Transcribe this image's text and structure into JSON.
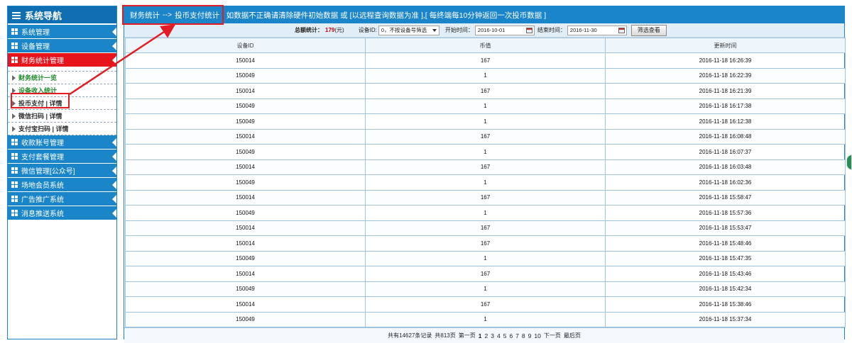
{
  "sidebar": {
    "title": "系统导航",
    "menu": [
      {
        "label": "系统管理"
      },
      {
        "label": "设备管理"
      },
      {
        "label": "财务统计管理"
      }
    ],
    "submenu": [
      {
        "label": "财务统计一览"
      },
      {
        "label": "设备收入统计"
      },
      {
        "label": "投币支付 | 详情"
      },
      {
        "label": "微信扫码 | 详情"
      },
      {
        "label": "支付宝扫码 | 详情"
      }
    ],
    "menu2": [
      {
        "label": "收款账号管理"
      },
      {
        "label": "支付套餐管理"
      },
      {
        "label": "微信管理[公众号]"
      },
      {
        "label": "场地会员系统"
      },
      {
        "label": "广告推广系统"
      },
      {
        "label": "消息推送系统"
      }
    ]
  },
  "topbar": {
    "crumb1": "财务统计",
    "sep": "-->",
    "crumb2": "投币支付统计",
    "notice": "| 如数据不正确请清除硬件初始数据 或 [以远程查询数据为准 ],[ 每终端每10分钟返回一次投币数据 ]"
  },
  "filter": {
    "total_label": "总额统计：",
    "total_value": "179",
    "total_unit": "(元)",
    "device_label": "设备ID:",
    "device_select": "0，不按设备号筛选",
    "start_label": "开始时间：",
    "start_value": "2016-10-01",
    "end_label": "结束时间：",
    "end_value": "2016-11-30",
    "button": "筛选查看"
  },
  "table": {
    "headers": [
      "设备ID",
      "币值",
      "更新时间"
    ],
    "rows": [
      [
        "150014",
        "167",
        "2016-11-18 16:26:39"
      ],
      [
        "150049",
        "1",
        "2016-11-18 16:22:39"
      ],
      [
        "150014",
        "167",
        "2016-11-18 16:21:39"
      ],
      [
        "150049",
        "1",
        "2016-11-18 16:17:38"
      ],
      [
        "150049",
        "1",
        "2016-11-18 16:12:38"
      ],
      [
        "150014",
        "167",
        "2016-11-18 16:08:48"
      ],
      [
        "150049",
        "1",
        "2016-11-18 16:07:37"
      ],
      [
        "150014",
        "167",
        "2016-11-18 16:03:48"
      ],
      [
        "150049",
        "1",
        "2016-11-18 16:02:36"
      ],
      [
        "150014",
        "167",
        "2016-11-18 15:58:47"
      ],
      [
        "150049",
        "1",
        "2016-11-18 15:57:36"
      ],
      [
        "150014",
        "167",
        "2016-11-18 15:53:47"
      ],
      [
        "150014",
        "167",
        "2016-11-18 15:48:46"
      ],
      [
        "150049",
        "1",
        "2016-11-18 15:47:35"
      ],
      [
        "150014",
        "167",
        "2016-11-18 15:43:46"
      ],
      [
        "150049",
        "1",
        "2016-11-18 15:42:34"
      ],
      [
        "150014",
        "167",
        "2016-11-18 15:38:46"
      ],
      [
        "150049",
        "1",
        "2016-11-18 15:37:34"
      ]
    ]
  },
  "pager": {
    "records": "共有14627条记录",
    "pages": "共813页",
    "first": "第一页",
    "numbers": [
      "1",
      "2",
      "3",
      "4",
      "5",
      "6",
      "7",
      "8",
      "9",
      "10"
    ],
    "next": "下一页",
    "last": "最后页"
  },
  "colors": {
    "primary": "#1a85c8",
    "active": "#e8141c",
    "annotation": "#e31b23"
  }
}
